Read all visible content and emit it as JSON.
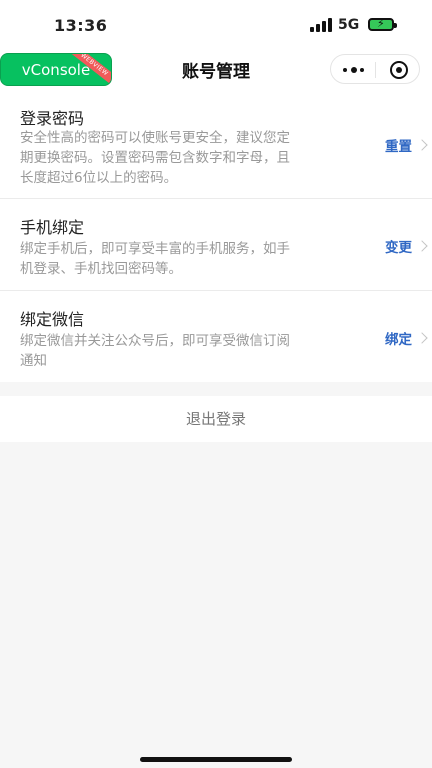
{
  "status_bar": {
    "time": "13:36",
    "network": "5G",
    "battery_color": "#35c759"
  },
  "vconsole": {
    "label": "vConsole",
    "ribbon": "WEBVIEW",
    "color": "#07c160"
  },
  "nav": {
    "title": "账号管理",
    "capsule_icons": [
      "more-icon",
      "target-icon"
    ]
  },
  "items": [
    {
      "title": "登录密码",
      "desc_line1": "安全性高的密码可以使账号更安全，建议您定",
      "desc_line2": "期更换密码。设置密码需包含数字和字母，且",
      "desc_line3": "长度超过6位以上的密码。",
      "action": "重置"
    },
    {
      "title": "手机绑定",
      "desc_line1": "绑定手机后，即可享受丰富的手机服务，如手",
      "desc_line2": "机登录、手机找回密码等。",
      "action": "变更"
    },
    {
      "title": "绑定微信",
      "desc_line1": "绑定微信并关注公众号后，即可享受微信订阅",
      "desc_line2": "通知",
      "action": "绑定"
    }
  ],
  "logout": {
    "label": "退出登录"
  },
  "colors": {
    "accent": "#3068c4",
    "background": "#f6f6f6"
  }
}
